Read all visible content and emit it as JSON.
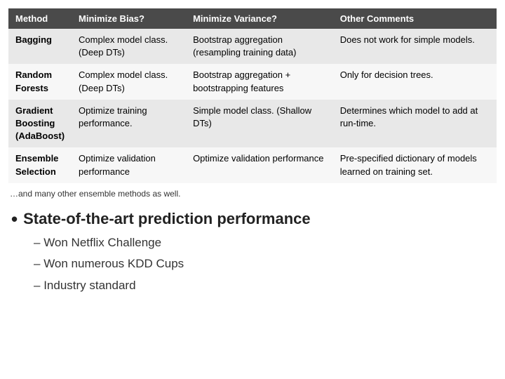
{
  "table": {
    "headers": [
      "Method",
      "Minimize Bias?",
      "Minimize Variance?",
      "Other Comments"
    ],
    "rows": [
      {
        "method": "Bagging",
        "minimize_bias": "Complex model class. (Deep DTs)",
        "minimize_variance": "Bootstrap aggregation (resampling training data)",
        "other_comments": "Does not work for simple models."
      },
      {
        "method": "Random\nForests",
        "minimize_bias": "Complex model class. (Deep DTs)",
        "minimize_variance": "Bootstrap aggregation + bootstrapping features",
        "other_comments": "Only for decision trees."
      },
      {
        "method": "Gradient\nBoosting\n(AdaBoost)",
        "minimize_bias": "Optimize training performance.",
        "minimize_variance": "Simple model class. (Shallow DTs)",
        "other_comments": "Determines which model to add at run-time."
      },
      {
        "method": "Ensemble\nSelection",
        "minimize_bias": "Optimize validation performance",
        "minimize_variance": "Optimize validation performance",
        "other_comments": "Pre-specified dictionary of models learned on training set."
      }
    ]
  },
  "footer_note": "…and many other ensemble methods as well.",
  "bullet": {
    "main_text": "State-of-the-art prediction performance",
    "sub_items": [
      "Won Netflix Challenge",
      "Won numerous KDD Cups",
      "Industry standard"
    ]
  }
}
